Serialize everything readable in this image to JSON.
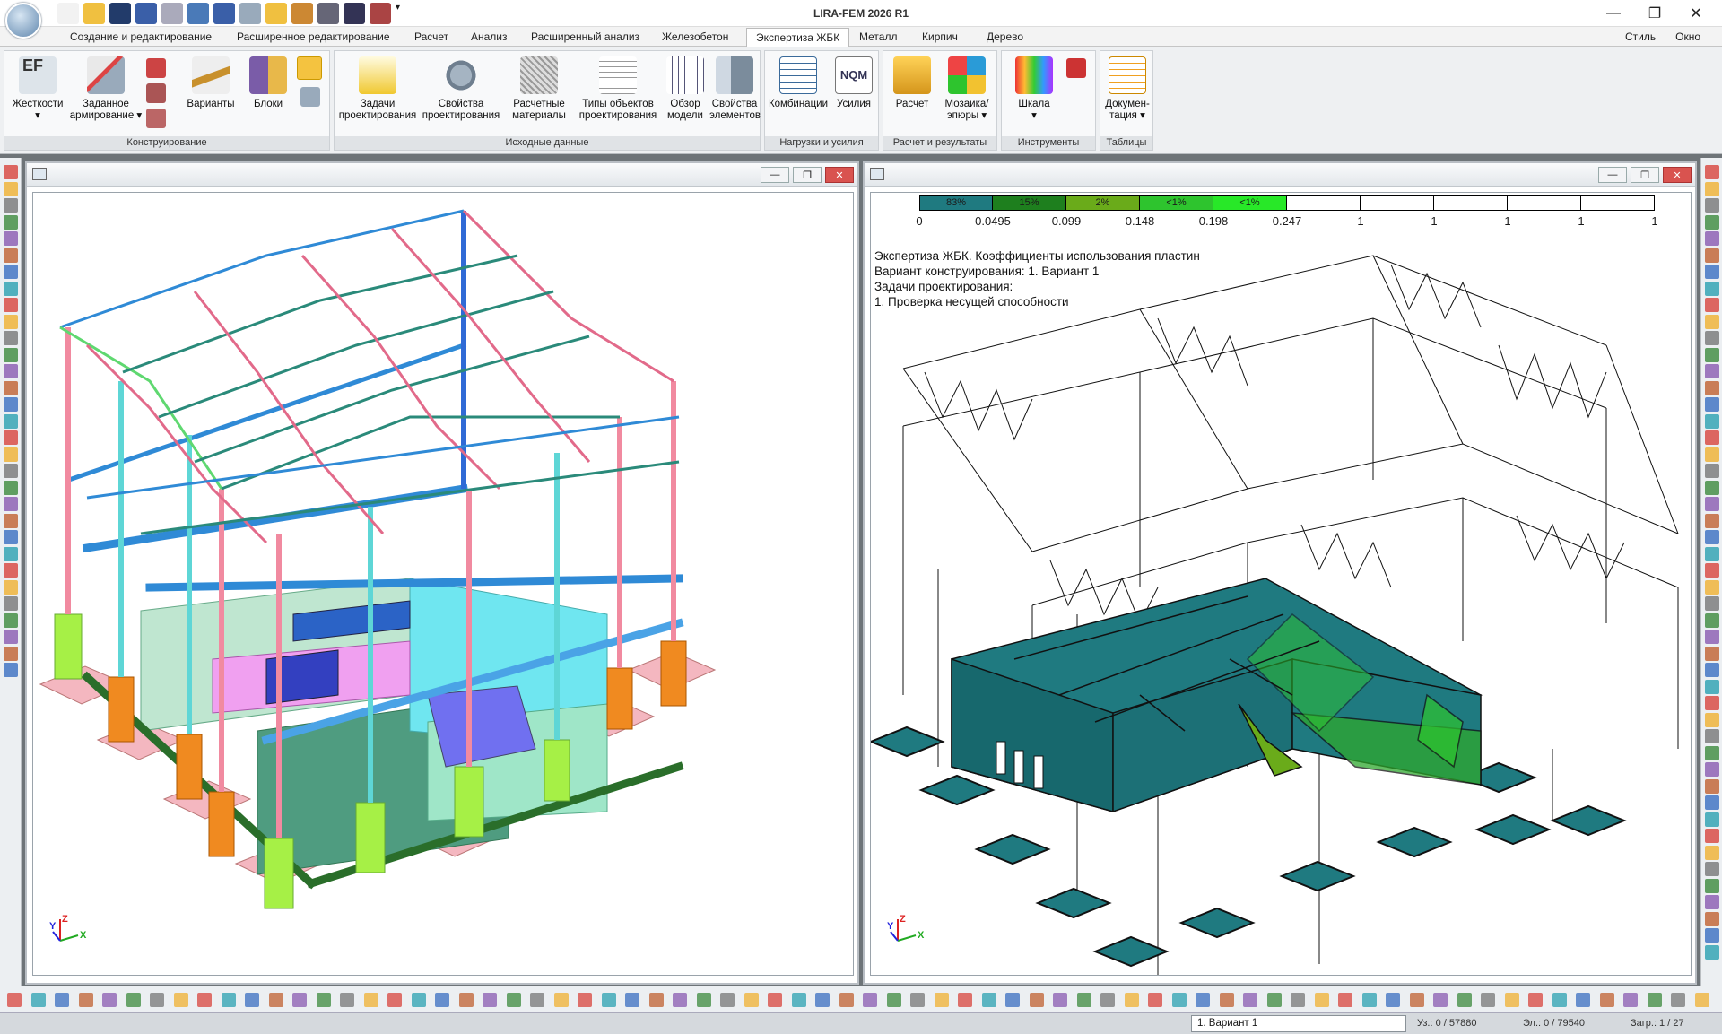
{
  "app": {
    "title": "LIRA-FEM 2026 R1"
  },
  "quick_access": {
    "icon_names": [
      "new-file-icon",
      "open-file-icon",
      "save-icon",
      "undo-icon",
      "redo-icon",
      "cube-icon",
      "book-icon",
      "print-icon",
      "hand-icon",
      "chart-icon",
      "lock-icon",
      "si-units-icon",
      "format-icon",
      "dropdown-icon"
    ]
  },
  "window_buttons": {
    "minimize": "—",
    "restore": "❐",
    "close": "✕"
  },
  "tabs": [
    {
      "label": "Создание и редактирование"
    },
    {
      "label": "Расширенное редактирование"
    },
    {
      "label": "Расчет"
    },
    {
      "label": "Анализ"
    },
    {
      "label": "Расширенный анализ"
    },
    {
      "label": "Железобетон"
    },
    {
      "label": "Экспертиза ЖБК",
      "active": true
    },
    {
      "label": "Металл"
    },
    {
      "label": "Кирпич"
    },
    {
      "label": "Дерево"
    }
  ],
  "tabs_right": {
    "style": "Стиль",
    "window": "Окно"
  },
  "ribbon": {
    "groups": [
      {
        "label": "Конструирование"
      },
      {
        "label": "Исходные данные"
      },
      {
        "label": "Нагрузки и усилия"
      },
      {
        "label": "Расчет и результаты"
      },
      {
        "label": "Инструменты"
      },
      {
        "label": "Таблицы"
      }
    ],
    "buttons": [
      {
        "line1": "Жесткости",
        "line2": "▾"
      },
      {
        "line1": "Заданное",
        "line2": "армирование ▾"
      },
      {
        "line1": "Варианты",
        "line2": ""
      },
      {
        "line1": "Блоки",
        "line2": ""
      },
      {
        "line1": "Задачи",
        "line2": "проектирования"
      },
      {
        "line1": "Свойства",
        "line2": "проектирования"
      },
      {
        "line1": "Расчетные",
        "line2": "материалы"
      },
      {
        "line1": "Типы объектов",
        "line2": "проектирования"
      },
      {
        "line1": "Обзор",
        "line2": "модели"
      },
      {
        "line1": "Свойства",
        "line2": "элементов"
      },
      {
        "line1": "Комбинации",
        "line2": ""
      },
      {
        "line1": "Усилия",
        "line2": ""
      },
      {
        "line1": "Расчет",
        "line2": ""
      },
      {
        "line1": "Мозаика/",
        "line2": "эпюры ▾"
      },
      {
        "line1": "Шкала",
        "line2": "▾"
      },
      {
        "line1": "Докумен-",
        "line2": "тация ▾"
      }
    ],
    "nqm_label": "NQM",
    "ef_label": "EF"
  },
  "right_view": {
    "legend": {
      "cells": [
        "83%",
        "15%",
        "2%",
        "<1%",
        "<1%",
        "",
        "",
        "",
        "",
        ""
      ],
      "colors": [
        "#1f7a80",
        "#1e7f1e",
        "#6aab1a",
        "#2ec42e",
        "#28e828",
        "#ffffff",
        "#ffffff",
        "#ffffff",
        "#ffffff",
        "#ffffff"
      ],
      "values": [
        "0",
        "0.0495",
        "0.099",
        "0.148",
        "0.198",
        "0.247",
        "1",
        "1",
        "1",
        "1",
        "1"
      ]
    },
    "info": [
      "Экспертиза ЖБК. Коэффициенты использования пластин",
      "Вариант конструирования: 1. Вариант 1",
      "Задачи проектирования:",
      "1. Проверка несущей способности"
    ]
  },
  "axes": {
    "x": "X",
    "y": "Y",
    "z": "Z"
  },
  "status": {
    "variant": "1. Вариант 1",
    "nodes": "Уз.: 0 / 57880",
    "elements": "Эл.: 0 / 79540",
    "loads": "Загр.: 1 / 27"
  },
  "colors": {
    "accent": "#2b6cb0",
    "plate_teal": "#1f7a80",
    "plate_green": "#2ec42e"
  }
}
